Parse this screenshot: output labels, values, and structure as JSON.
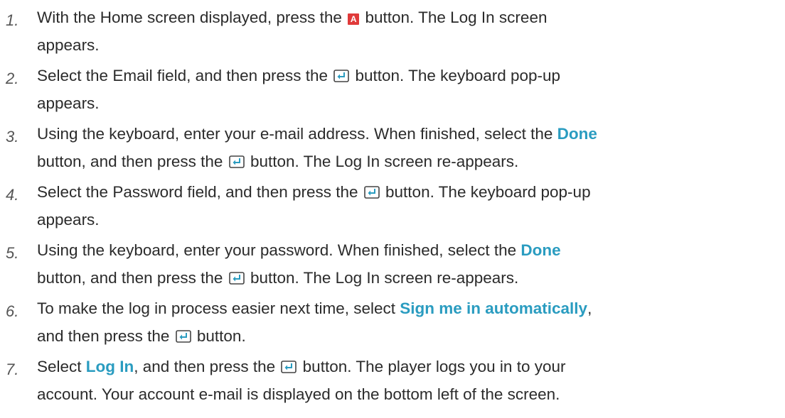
{
  "steps": [
    {
      "num": "1.",
      "lines": [
        [
          {
            "t": "text",
            "v": "With the Home screen displayed, press the "
          },
          {
            "t": "btn-a",
            "v": "A"
          },
          {
            "t": "text",
            "v": " button. The Log In screen"
          }
        ],
        [
          {
            "t": "text",
            "v": "appears."
          }
        ]
      ]
    },
    {
      "num": "2.",
      "lines": [
        [
          {
            "t": "text",
            "v": "Select the Email field, and then press the "
          },
          {
            "t": "icon",
            "v": "enter-icon"
          },
          {
            "t": "text",
            "v": " button. The keyboard pop-up"
          }
        ],
        [
          {
            "t": "text",
            "v": "appears."
          }
        ]
      ]
    },
    {
      "num": "3.",
      "lines": [
        [
          {
            "t": "text",
            "v": "Using the keyboard, enter your e-mail address. When finished, select the "
          },
          {
            "t": "hl",
            "v": "Done"
          }
        ],
        [
          {
            "t": "text",
            "v": "button, and then press the "
          },
          {
            "t": "icon",
            "v": "enter-icon"
          },
          {
            "t": "text",
            "v": " button. The Log In screen re-appears."
          }
        ]
      ]
    },
    {
      "num": "4.",
      "lines": [
        [
          {
            "t": "text",
            "v": "Select the Password field, and then press the "
          },
          {
            "t": "icon",
            "v": "enter-icon"
          },
          {
            "t": "text",
            "v": " button. The keyboard pop-up"
          }
        ],
        [
          {
            "t": "text",
            "v": "appears."
          }
        ]
      ]
    },
    {
      "num": "5.",
      "lines": [
        [
          {
            "t": "text",
            "v": "Using the keyboard, enter your password. When finished, select the "
          },
          {
            "t": "hl",
            "v": "Done"
          }
        ],
        [
          {
            "t": "text",
            "v": "button, and then press the "
          },
          {
            "t": "icon",
            "v": "enter-icon"
          },
          {
            "t": "text",
            "v": " button. The Log In screen re-appears."
          }
        ]
      ]
    },
    {
      "num": "6.",
      "lines": [
        [
          {
            "t": "text",
            "v": "To make the log in process easier next time, select "
          },
          {
            "t": "hl",
            "v": "Sign me in automatically"
          },
          {
            "t": "text",
            "v": ","
          }
        ],
        [
          {
            "t": "text",
            "v": "and then press the "
          },
          {
            "t": "icon",
            "v": "enter-icon"
          },
          {
            "t": "text",
            "v": " button."
          }
        ]
      ]
    },
    {
      "num": "7.",
      "lines": [
        [
          {
            "t": "text",
            "v": "Select "
          },
          {
            "t": "hl",
            "v": "Log In"
          },
          {
            "t": "text",
            "v": ", and then press the "
          },
          {
            "t": "icon",
            "v": "enter-icon"
          },
          {
            "t": "text",
            "v": " button. The player logs you in to your"
          }
        ],
        [
          {
            "t": "text",
            "v": "account. Your account e-mail is displayed on the bottom left of the screen."
          }
        ]
      ]
    }
  ],
  "colors": {
    "text": "#2b2b2b",
    "highlight": "#2a9cc0",
    "a_button": "#e03a3a"
  }
}
